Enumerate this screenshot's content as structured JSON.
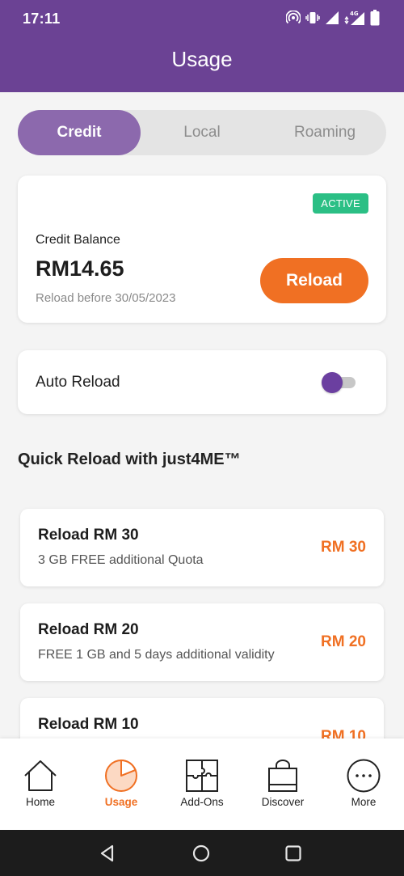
{
  "status_bar": {
    "time": "17:11",
    "network": "4G"
  },
  "header": {
    "title": "Usage"
  },
  "tabs": [
    {
      "label": "Credit",
      "active": true
    },
    {
      "label": "Local",
      "active": false
    },
    {
      "label": "Roaming",
      "active": false
    }
  ],
  "credit": {
    "badge": "ACTIVE",
    "label": "Credit Balance",
    "amount": "RM14.65",
    "expiry": "Reload before 30/05/2023",
    "reload_button": "Reload"
  },
  "auto_reload": {
    "label": "Auto Reload",
    "enabled": false
  },
  "quick_reload": {
    "title": "Quick Reload with just4ME™",
    "items": [
      {
        "title": "Reload RM 30",
        "description": "3 GB FREE additional Quota",
        "price": "RM 30"
      },
      {
        "title": "Reload RM 20",
        "description": "FREE 1 GB and 5 days additional validity",
        "price": "RM 20"
      },
      {
        "title": "Reload RM 10",
        "description": "",
        "price": "RM 10"
      }
    ]
  },
  "bottom_nav": [
    {
      "label": "Home",
      "icon": "home-icon",
      "active": false
    },
    {
      "label": "Usage",
      "icon": "usage-pie-icon",
      "active": true
    },
    {
      "label": "Add-Ons",
      "icon": "puzzle-icon",
      "active": false
    },
    {
      "label": "Discover",
      "icon": "shopping-bag-icon",
      "active": false
    },
    {
      "label": "More",
      "icon": "more-dots-icon",
      "active": false
    }
  ],
  "colors": {
    "brand_purple": "#6b4294",
    "tab_active": "#8c69ad",
    "accent_orange": "#f07023",
    "active_green": "#2bbf85"
  }
}
